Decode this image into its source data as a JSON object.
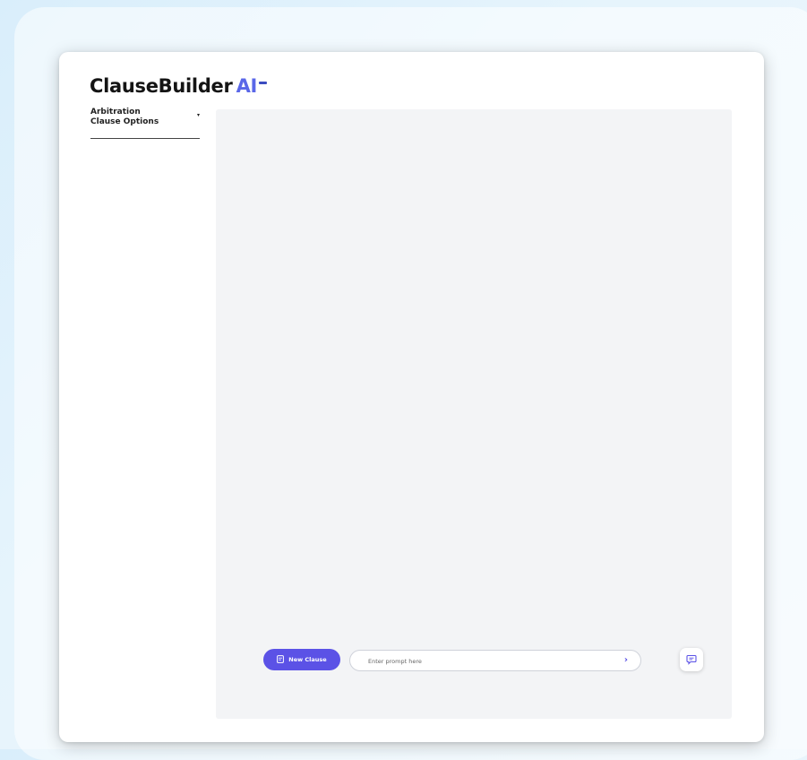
{
  "brand": {
    "name": "ClauseBuilder",
    "suffix": "AI"
  },
  "sidebar": {
    "selector_label": "Arbitration\nClause Options",
    "selector_caret": "▾"
  },
  "composer": {
    "new_clause_label": "New Clause",
    "prompt_placeholder": "Enter prompt here",
    "prompt_value": "",
    "send_glyph": "›"
  },
  "icons": {
    "new_clause": "document-icon",
    "send": "chevron-right-icon",
    "chat": "chat-bubble-icon"
  },
  "colors": {
    "accent": "#5b52e6",
    "brand_ai": "#5a67e8",
    "canvas_bg": "#f3f4f6"
  }
}
